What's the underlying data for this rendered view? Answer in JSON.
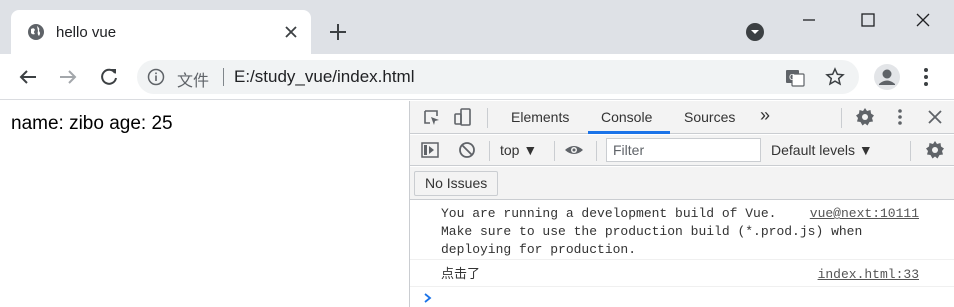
{
  "browser": {
    "tab_title": "hello vue",
    "omnibox": {
      "origin_label": "文件",
      "url": "E:/study_vue/index.html"
    }
  },
  "page": {
    "text": "name: zibo age: 25"
  },
  "devtools": {
    "tabs": [
      "Elements",
      "Console",
      "Sources"
    ],
    "active_tab": "Console",
    "more_tabs_glyph": "»",
    "context": "top",
    "filter_placeholder": "Filter",
    "levels_label": "Default levels",
    "issues_label": "No Issues",
    "messages": [
      {
        "text": "You are running a development build of Vue.\nMake sure to use the production build (*.prod.js) when\ndeploying for production.",
        "source": "vue@next:10111"
      },
      {
        "text": "点击了",
        "source": "index.html:33"
      }
    ]
  },
  "colors": {
    "accent": "#1a73e8",
    "tabstrip": "#dee1e6",
    "devtools_bar": "#f3f3f3"
  }
}
